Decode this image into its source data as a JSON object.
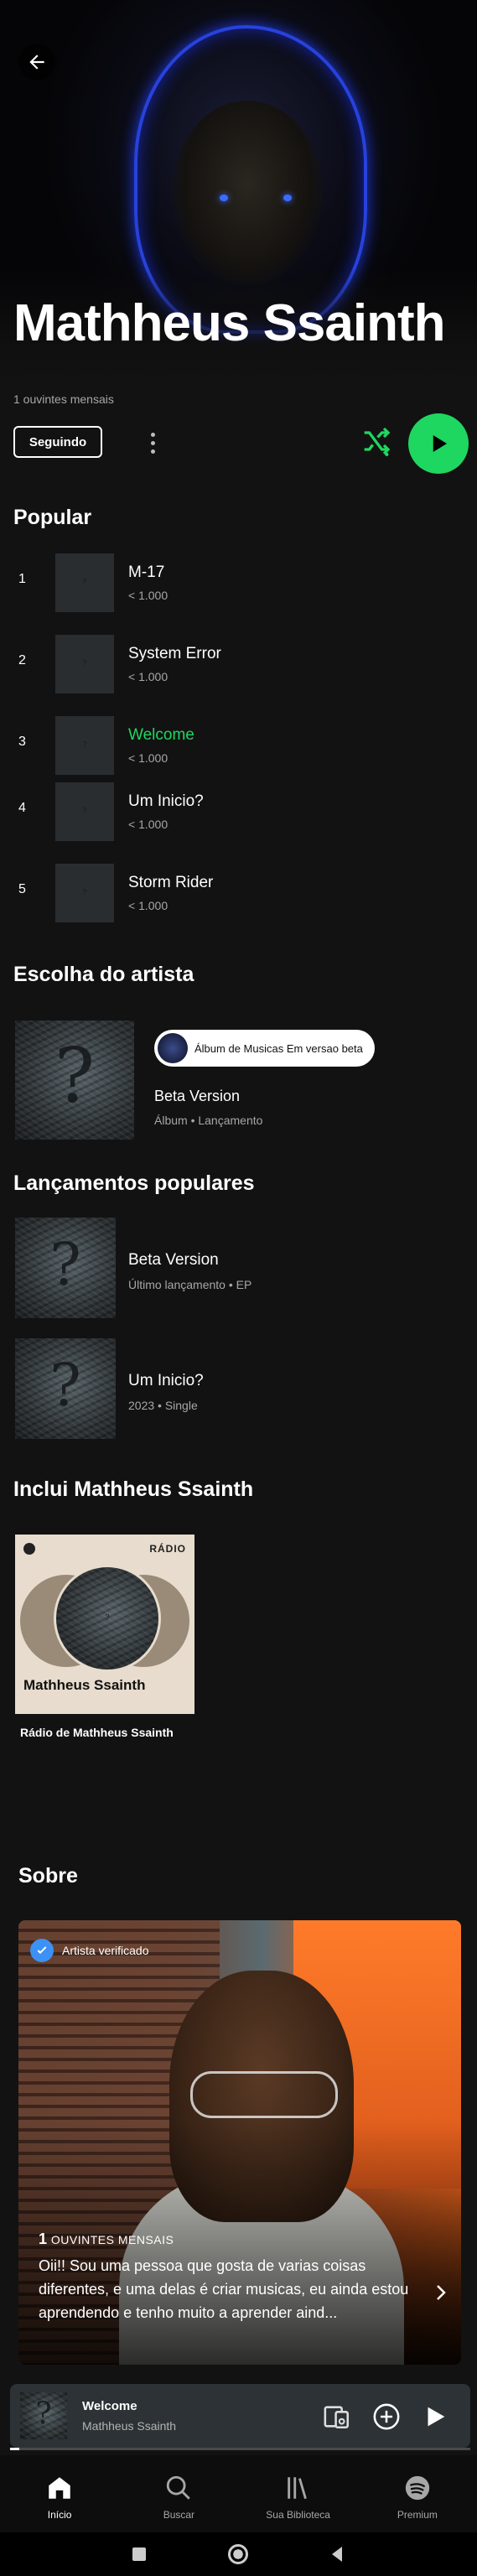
{
  "artist": {
    "name": "Mathheus Ssainth",
    "monthly_listeners": "1 ouvintes mensais",
    "follow_label": "Seguindo"
  },
  "popular": {
    "title": "Popular",
    "tracks": [
      {
        "number": "1",
        "name": "M-17",
        "plays": "< 1.000"
      },
      {
        "number": "2",
        "name": "System Error",
        "plays": "< 1.000"
      },
      {
        "number": "3",
        "name": "Welcome",
        "plays": "< 1.000",
        "playing": true
      },
      {
        "number": "4",
        "name": "Um Inicio?",
        "plays": "< 1.000"
      },
      {
        "number": "5",
        "name": "Storm Rider",
        "plays": "< 1.000"
      }
    ]
  },
  "artist_pick": {
    "title": "Escolha do artista",
    "badge": "Álbum de Musicas Em versao beta",
    "name": "Beta Version",
    "meta": "Álbum • Lançamento"
  },
  "releases": {
    "title": "Lançamentos populares",
    "items": [
      {
        "name": "Beta Version",
        "meta": "Último lançamento • EP"
      },
      {
        "name": "Um Inicio?",
        "meta": "2023 • Single"
      }
    ]
  },
  "featuring": {
    "title": "Inclui Mathheus Ssainth",
    "radio_label": "RÁDIO",
    "card_name": "Mathheus Ssainth",
    "caption": "Rádio de Mathheus Ssainth"
  },
  "about": {
    "title": "Sobre",
    "verified": "Artista verificado",
    "listeners_count": "1",
    "listeners_label": "OUVINTES MENSAIS",
    "bio": "Oii!! Sou uma pessoa que gosta de varias coisas diferentes, e uma delas é criar musicas, eu ainda estou aprendendo e tenho muito a aprender aind..."
  },
  "now_playing": {
    "title": "Welcome",
    "artist": "Mathheus Ssainth",
    "progress": 0.02
  },
  "nav": [
    {
      "label": "Início",
      "icon": "home-icon",
      "active": true
    },
    {
      "label": "Buscar",
      "icon": "search-icon"
    },
    {
      "label": "Sua Biblioteca",
      "icon": "library-icon"
    },
    {
      "label": "Premium",
      "icon": "spotify-icon"
    }
  ],
  "colors": {
    "accent": "#1ed760",
    "background": "#121212",
    "verified": "#3d91f4"
  }
}
